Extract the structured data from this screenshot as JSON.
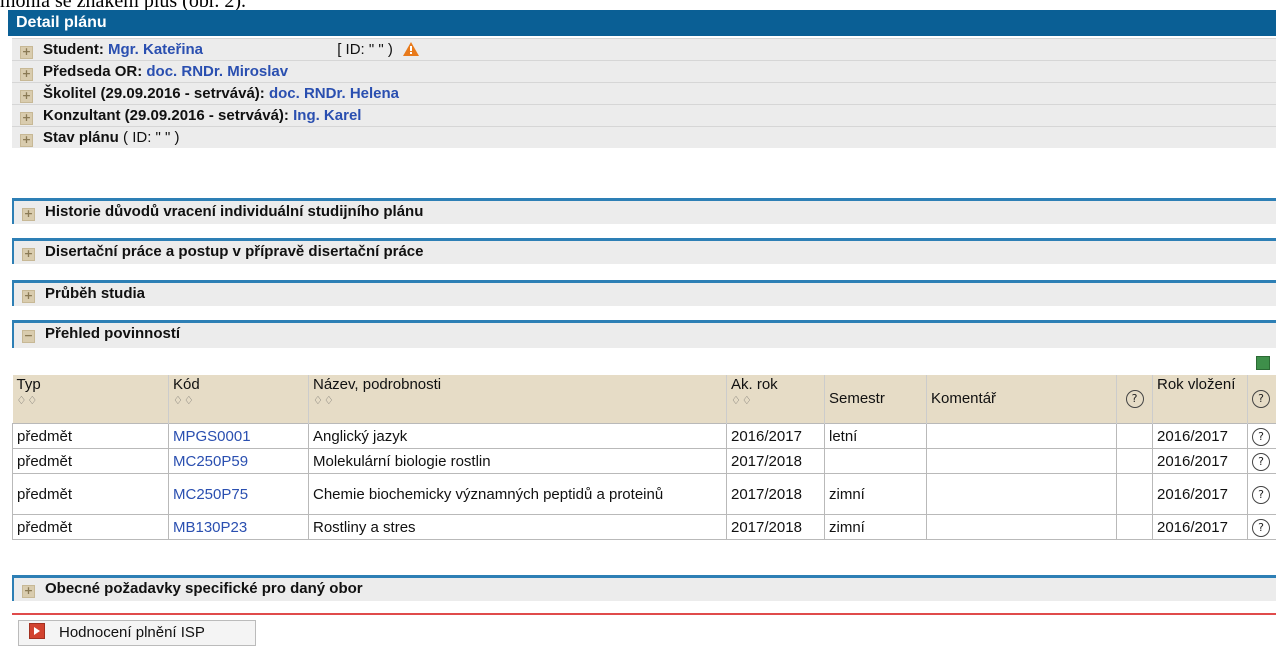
{
  "top_text": "mohla se znakem plus (obr. 2).",
  "panel_title": "Detail plánu",
  "info_rows": [
    {
      "label": "Student:",
      "value": "Mgr. Kateřina",
      "extra": "[ ID: \"            \" )"
    },
    {
      "label": "Předseda OR:",
      "value": "doc. RNDr. Miroslav",
      "extra": ""
    },
    {
      "label": "Školitel (29.09.2016 - setrvává):",
      "value": "doc. RNDr. Helena",
      "extra": ""
    },
    {
      "label": "Konzultant (29.09.2016 - setrvává):",
      "value": "Ing. Karel",
      "extra": ""
    },
    {
      "label": "Stav plánu",
      "value": "",
      "extra": "( ID: \"          \" )"
    }
  ],
  "sections": {
    "history": "Historie důvodů vracení individuální studijního plánu",
    "thesis": "Disertační práce a postup v přípravě disertační práce",
    "course": "Průběh studia",
    "duties": "Přehled povinností",
    "general": "Obecné požadavky specifické pro daný obor"
  },
  "table": {
    "headers": {
      "typ": "Typ",
      "kod": "Kód",
      "nazev": "Název, podrobnosti",
      "ak_rok": "Ak. rok",
      "semestr": "Semestr",
      "komentar": "Komentář",
      "rok_vlozeni": "Rok vložení",
      "sort": "♢♢",
      "help": "?"
    },
    "rows": [
      {
        "typ": "předmět",
        "kod": "MPGS0001",
        "nazev": "Anglický jazyk",
        "ak_rok": "2016/2017",
        "semestr": "letní",
        "komentar": "",
        "rok_vlozeni": "2016/2017"
      },
      {
        "typ": "předmět",
        "kod": "MC250P59",
        "nazev": "Molekulární biologie rostlin",
        "ak_rok": "2017/2018",
        "semestr": "",
        "komentar": "",
        "rok_vlozeni": "2016/2017"
      },
      {
        "typ": "předmět",
        "kod": "MC250P75",
        "nazev": "Chemie biochemicky významných peptidů a proteinů",
        "ak_rok": "2017/2018",
        "semestr": "zimní",
        "komentar": "",
        "rok_vlozeni": "2016/2017"
      },
      {
        "typ": "předmět",
        "kod": "MB130P23",
        "nazev": "Rostliny a stres",
        "ak_rok": "2017/2018",
        "semestr": "zimní",
        "komentar": "",
        "rok_vlozeni": "2016/2017"
      }
    ]
  },
  "eval_button": "Hodnocení plnění ISP",
  "icons": {
    "expand": "+",
    "collapse": "−",
    "warning": "warning-icon",
    "excel": "excel-export-icon",
    "help": "help-icon"
  },
  "colors": {
    "title_bar": "#0a5f95",
    "section_border": "#2d7fb5",
    "link": "#2a4fb0",
    "header_bg": "#e6dcc6",
    "warning": "#e87a1b",
    "bottom_line": "#e04b4b"
  }
}
